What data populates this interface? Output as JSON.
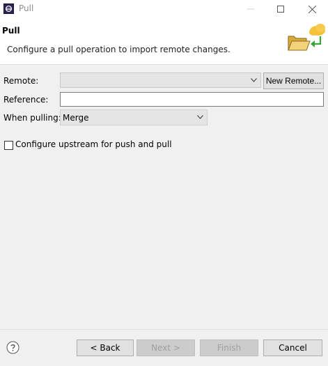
{
  "window": {
    "title": "Pull"
  },
  "header": {
    "title": "Pull",
    "description": "Configure a pull operation to import remote changes."
  },
  "form": {
    "remote_label": "Remote:",
    "remote_value": "",
    "new_remote_label": "New Remote...",
    "reference_label": "Reference:",
    "reference_value": "",
    "when_pulling_label": "When pulling:",
    "when_pulling_value": "Merge",
    "configure_upstream_label": "Configure upstream for push and pull",
    "configure_upstream_checked": false
  },
  "footer": {
    "back_label": "< Back",
    "next_label": "Next >",
    "finish_label": "Finish",
    "cancel_label": "Cancel"
  },
  "icons": {
    "app": "eclipse-icon",
    "header": "folder-pull-icon",
    "help": "help-icon"
  }
}
